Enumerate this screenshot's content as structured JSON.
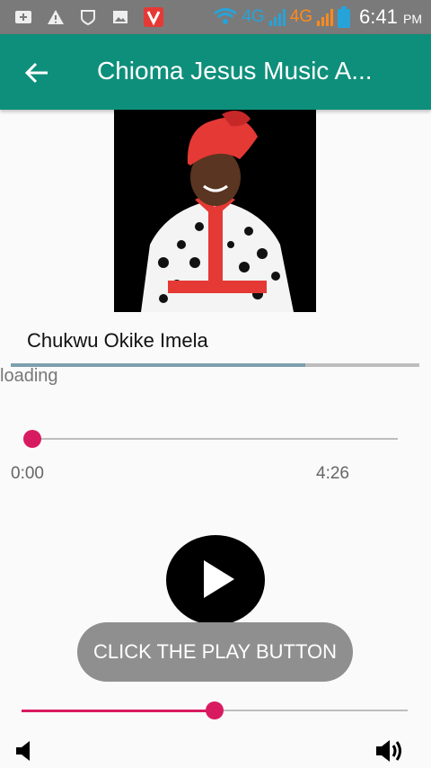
{
  "status_bar": {
    "network_1": "4G",
    "network_2": "4G",
    "time": "6:41",
    "ampm": "PM"
  },
  "app_bar": {
    "title": "Chioma Jesus Music A..."
  },
  "player": {
    "song_title": "Chukwu Okike Imela",
    "loading_text": "loading",
    "buffer_progress": 0.72,
    "time_elapsed": "0:00",
    "time_total": "4:26",
    "seek_position": 0.0,
    "volume_level": 0.5
  },
  "toast": {
    "message": "CLICK THE PLAY BUTTON"
  },
  "colors": {
    "app_bar": "#0e8f7b",
    "accent": "#d81b60",
    "buffer": "#7e9fae"
  }
}
